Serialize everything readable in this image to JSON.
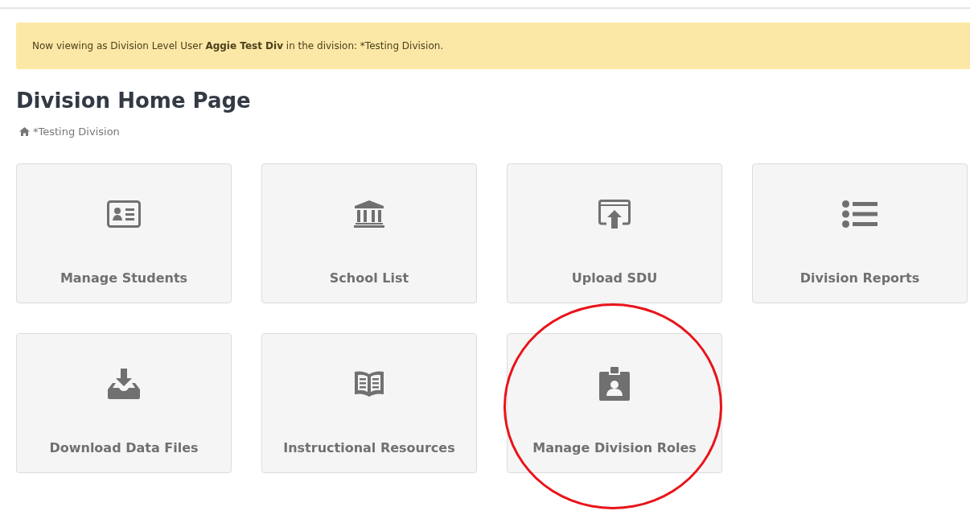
{
  "banner": {
    "text": "Now viewing as Division Level User **Aggie Test Div** in the division: *Testing Division."
  },
  "page_title": "Division Home Page",
  "breadcrumb": {
    "label": "*Testing Division"
  },
  "tiles": [
    {
      "label": "Manage Students",
      "circled": false
    },
    {
      "label": "School List",
      "circled": false
    },
    {
      "label": "Upload SDU",
      "circled": false
    },
    {
      "label": "Division Reports",
      "circled": false
    },
    {
      "label": "Download Data Files",
      "circled": false
    },
    {
      "label": "Instructional Resources",
      "circled": false
    },
    {
      "label": "Manage Division Roles",
      "circled": true
    }
  ]
}
